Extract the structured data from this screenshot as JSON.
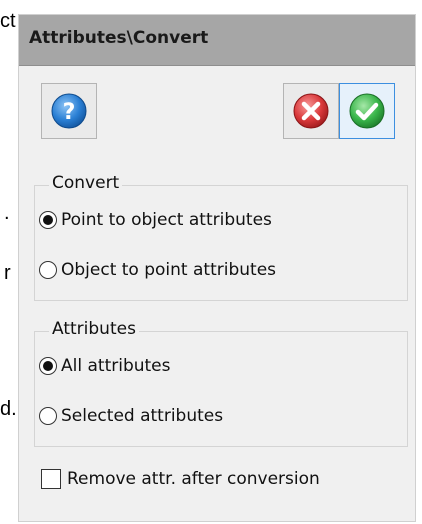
{
  "background_fragments": [
    "ct",
    ".",
    "r",
    "d."
  ],
  "dialog": {
    "title": "Attributes\\Convert",
    "toolbar": {
      "help_icon": "help-icon",
      "cancel_icon": "cancel-icon",
      "ok_icon": "ok-icon",
      "colors": {
        "help": "#2a7fd4",
        "cancel": "#d9383a",
        "ok": "#39b54a",
        "selected_border": "#3c8fe0"
      }
    },
    "convert": {
      "title": "Convert",
      "options": [
        {
          "label": "Point to object attributes",
          "selected": true
        },
        {
          "label": "Object to point attributes",
          "selected": false
        }
      ]
    },
    "attributes": {
      "title": "Attributes",
      "options": [
        {
          "label": "All attributes",
          "selected": true
        },
        {
          "label": "Selected attributes",
          "selected": false
        }
      ]
    },
    "remove_after": {
      "label": "Remove attr. after conversion",
      "checked": false
    }
  }
}
